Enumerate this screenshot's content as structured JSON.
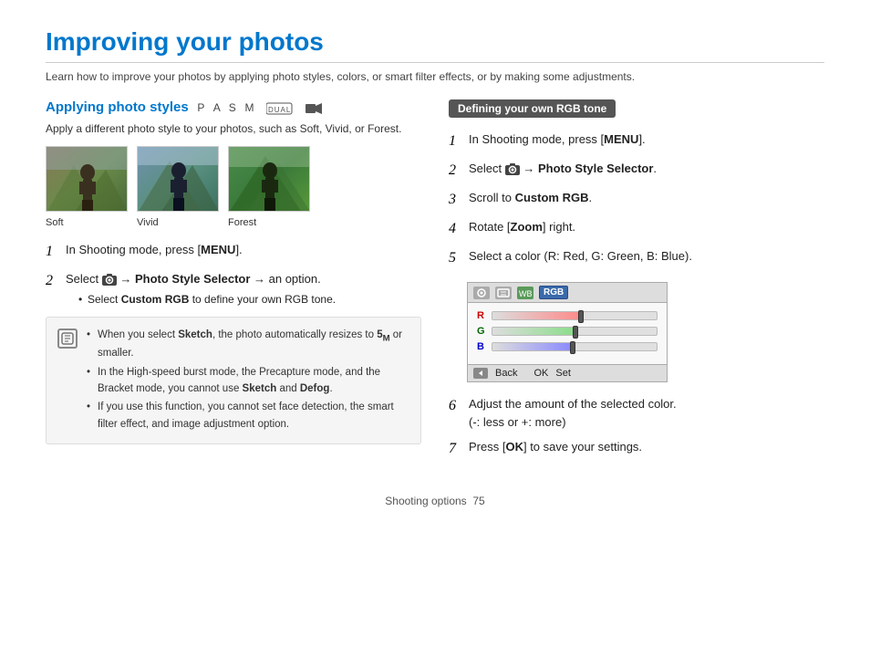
{
  "page": {
    "title": "Improving your photos",
    "subtitle": "Learn how to improve your photos by applying photo styles, colors, or smart filter effects, or by making some adjustments.",
    "footer": "Shooting options",
    "page_number": "75"
  },
  "left": {
    "section_title": "Applying photo styles",
    "section_modes": "P A S M  DUAL  🎥",
    "section_desc": "Apply a different photo style to your photos, such as Soft, Vivid, or Forest.",
    "photos": [
      {
        "style": "soft",
        "label": "Soft"
      },
      {
        "style": "vivid",
        "label": "Vivid"
      },
      {
        "style": "forest",
        "label": "Forest"
      }
    ],
    "steps": [
      {
        "num": "1",
        "text": "In Shooting mode, press [MENU].",
        "subs": []
      },
      {
        "num": "2",
        "text_before": "Select ",
        "cam": true,
        "text_mid": " → ",
        "bold": "Photo Style Selector",
        "text_after": " → an option.",
        "subs": [
          "Select Custom RGB to define your own RGB tone."
        ]
      }
    ],
    "note": {
      "bullets": [
        "When you select Sketch, the photo automatically resizes to 5M or smaller.",
        "In the High-speed burst mode, the Precapture mode, and the Bracket mode, you cannot use Sketch and Defog.",
        "If you use this function, you cannot set face detection, the smart filter effect, and image adjustment option."
      ]
    }
  },
  "right": {
    "badge": "Defining your own RGB tone",
    "steps": [
      {
        "num": "1",
        "text": "In Shooting mode, press [MENU]."
      },
      {
        "num": "2",
        "text_parts": [
          "Select ",
          "cam",
          " → ",
          "bold:Photo Style Selector",
          "."
        ]
      },
      {
        "num": "3",
        "text_parts": [
          "Scroll to ",
          "bold:Custom RGB",
          "."
        ]
      },
      {
        "num": "4",
        "text_parts": [
          "Rotate [",
          "bold:Zoom",
          "] right."
        ]
      },
      {
        "num": "5",
        "text": "Select a color (R: Red, G: Green, B: Blue)."
      },
      {
        "num": "6",
        "text": "Adjust the amount of the selected color.\n(-: less or +: more)"
      },
      {
        "num": "7",
        "text_parts": [
          "Press [",
          "bold:OK",
          "] to save your settings."
        ]
      }
    ],
    "rgb_ui": {
      "title_icons": [
        "img",
        "img",
        "img",
        "RGB"
      ],
      "rows": [
        {
          "label": "R",
          "fill": 55
        },
        {
          "label": "G",
          "fill": 52
        },
        {
          "label": "B",
          "fill": 50
        }
      ],
      "footer_back": "Back",
      "footer_set": "Set"
    }
  }
}
